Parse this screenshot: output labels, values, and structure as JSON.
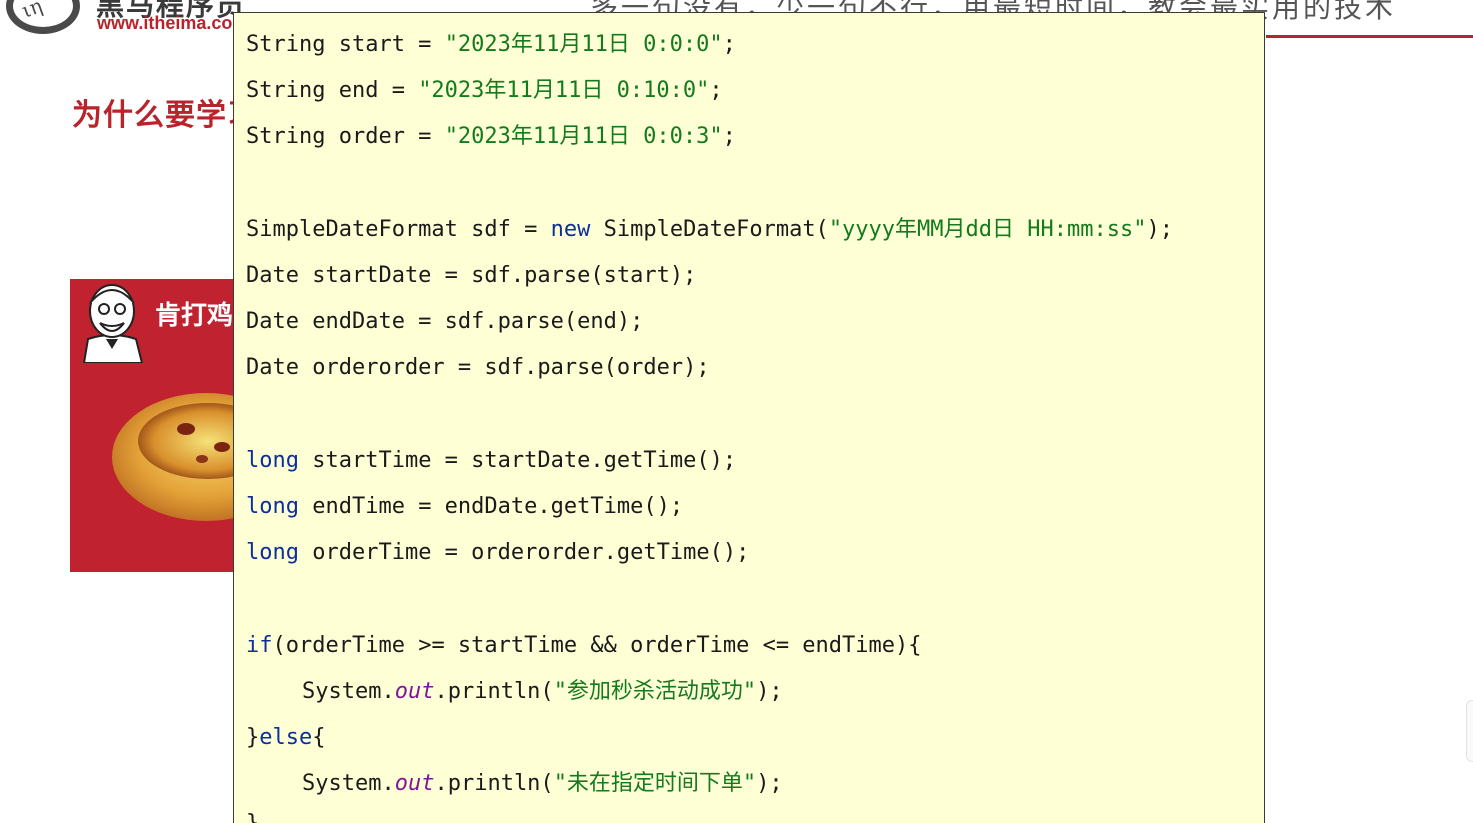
{
  "slide": {
    "brand_name": "黑马程序员",
    "brand_url": "www.itheima.com",
    "slogan": "多一句没有，少一句不行，用最短时间，教会最实用的技术",
    "section_title": "为什么要学习",
    "promo_text": "肯打鸡",
    "colors": {
      "brand_red": "#b8242c",
      "code_background": "#ffffd6",
      "keyword": "#0c2f9e",
      "string": "#137a1e",
      "static_field": "#7f159c"
    },
    "icons": [
      "logo-icon",
      "kfc-mascot-icon",
      "egg-tart-image"
    ]
  },
  "code": {
    "l1": {
      "a": "String start = ",
      "s": "\"2023年11月11日 0:0:0\"",
      "b": ";"
    },
    "l2": {
      "a": "String end = ",
      "s": "\"2023年11月11日 0:10:0\"",
      "b": ";"
    },
    "l3": {
      "a": "String order = ",
      "s": "\"2023年11月11日 0:0:3\"",
      "b": ";"
    },
    "l4": {
      "a": "SimpleDateFormat sdf = ",
      "kw": "new",
      "b": " SimpleDateFormat(",
      "s": "\"yyyy年MM月dd日 HH:mm:ss\"",
      "c": ");"
    },
    "l5": {
      "a": "Date startDate = sdf.parse(start);"
    },
    "l6": {
      "a": "Date endDate = sdf.parse(end);"
    },
    "l7": {
      "a": "Date orderorder = sdf.parse(order);"
    },
    "l8": {
      "kw": "long",
      "a": " startTime = startDate.getTime();"
    },
    "l9": {
      "kw": "long",
      "a": " endTime = endDate.getTime();"
    },
    "l10": {
      "kw": "long",
      "a": " orderTime = orderorder.getTime();"
    },
    "l11": {
      "kw": "if",
      "a": "(orderTime >= startTime && orderTime <= endTime){"
    },
    "l12": {
      "a": "System.",
      "f": "out",
      "b": ".println(",
      "s": "\"参加秒杀活动成功\"",
      "c": ");"
    },
    "l13": {
      "a": "}",
      "kw": "else",
      "b": "{"
    },
    "l14": {
      "a": "System.",
      "f": "out",
      "b": ".println(",
      "s": "\"未在指定时间下单\"",
      "c": ");"
    },
    "l15": {
      "a": "}"
    }
  }
}
